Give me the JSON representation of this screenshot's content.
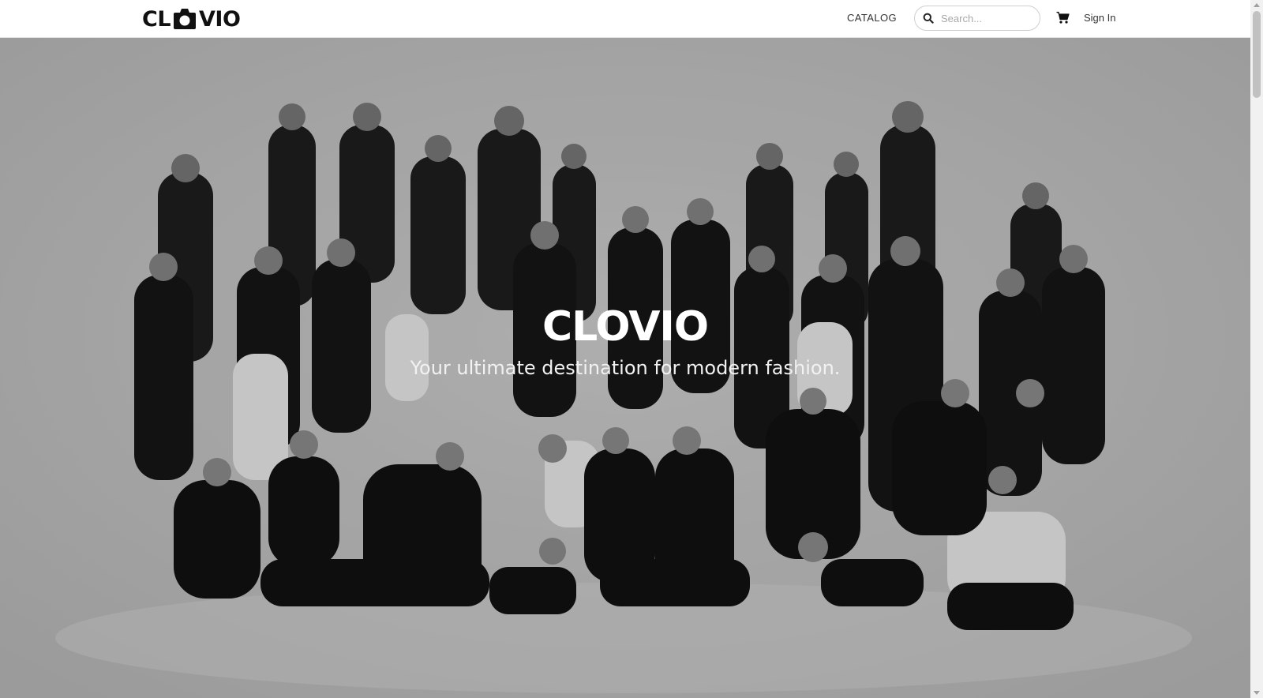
{
  "nav": {
    "logo_text_left": "CL",
    "logo_text_right": "VIO",
    "catalog_label": "CATALOG",
    "search_placeholder": "Search...",
    "search_value": "",
    "sign_in_label": "Sign In",
    "icons": [
      "logo-camera-mark",
      "search-icon",
      "cart-icon"
    ]
  },
  "hero": {
    "title": "CLOVIO",
    "subtitle": "Your ultimate destination for modern fashion.",
    "image": "black-and-white group portrait of fashion models"
  },
  "colors": {
    "navbar_bg": "#ffffff",
    "text_dark": "#111111",
    "hero_bg": "#b5b5b5",
    "hero_text": "#ffffff"
  }
}
